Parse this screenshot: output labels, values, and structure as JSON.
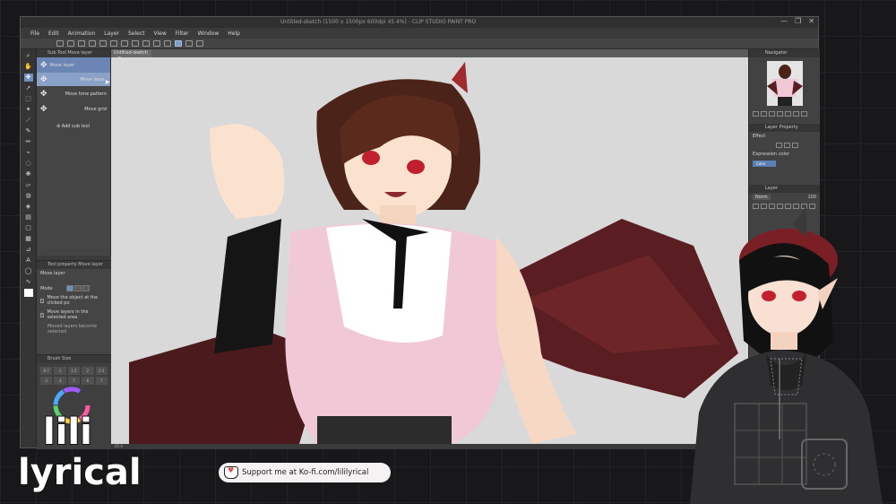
{
  "window": {
    "title": "Untitled-sketch (1500 x 1500px 600dpi 45.4%)  - CLIP STUDIO PAINT PRO",
    "controls": [
      "—",
      "❐",
      "✕"
    ]
  },
  "menu": [
    "File",
    "Edit",
    "Animation",
    "Layer",
    "Select",
    "View",
    "Filter",
    "Window",
    "Help"
  ],
  "sub_tool": {
    "header": "Sub Tool Move layer",
    "items": [
      {
        "label": "Move layer",
        "active": true
      },
      {
        "label": "Move layer",
        "hover": true
      },
      {
        "label": "Move tone pattern"
      },
      {
        "label": "Move grid"
      }
    ],
    "add_label": "Add sub tool"
  },
  "tool_property": {
    "header": "Tool property Move layer",
    "title": "Move layer",
    "mode_label": "Mode",
    "options": [
      "Move the object at the clicked po",
      "Move layers in the selected area",
      "Moved layers become selected"
    ]
  },
  "brush_size": {
    "header": "Brush Size",
    "values": [
      "0.7",
      "1",
      "1.5",
      "2",
      "2.5",
      "3",
      "4",
      "5",
      "6",
      "7"
    ]
  },
  "canvas": {
    "tab_label": "Untitled-sketch",
    "tab_close": "×",
    "status_zoom": "45.4"
  },
  "right_panels": {
    "navigator_header": "Navigator",
    "layer_property_header": "Layer Property",
    "effect_label": "Effect",
    "expression_color_label": "Expression color",
    "color_value": "Color",
    "layer_header": "Layer",
    "blend_mode": "Norm",
    "opacity": "100"
  },
  "overlay": {
    "logo_top": "lili",
    "logo_bottom": "lyrical",
    "kofi_text": "Support me at Ko-fi.com/lililyrical"
  },
  "colors": {
    "accent": "#6e8fc0",
    "window_bg": "#3b3b3b",
    "canvas_bg": "#d9d9d9",
    "kofi_heart": "#e0504e"
  }
}
